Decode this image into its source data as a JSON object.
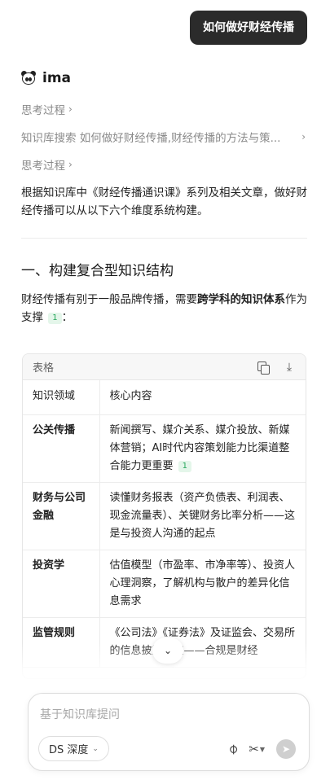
{
  "user_message": "如何做好财经传播",
  "assistant": {
    "name": "ima"
  },
  "steps": [
    {
      "label": "思考过程"
    },
    {
      "label": "知识库搜索 如何做好财经传播,财经传播的方法与策..."
    },
    {
      "label": "思考过程"
    }
  ],
  "intro": "根据知识库中《财经传播通识课》系列及相关文章，做好财经传播可以从以下六个维度系统构建。",
  "section": {
    "title": "一、构建复合型知识结构",
    "para_before": "财经传播有别于一般品牌传播，需要",
    "para_bold": "跨学科的知识体系",
    "para_after": "作为支撑",
    "para_end": "：",
    "citation": "1"
  },
  "table": {
    "label": "表格",
    "headers": [
      "知识领域",
      "核心内容"
    ],
    "rows": [
      {
        "domain": "公关传播",
        "content": "新闻撰写、媒介关系、媒介投放、新媒体营销；AI时代内容策划能力比渠道整合能力更重要",
        "citation": "1"
      },
      {
        "domain": "财务与公司金融",
        "content": "读懂财务报表（资产负债表、利润表、现金流量表）、关键财务比率分析——这是与投资人沟通的起点"
      },
      {
        "domain": "投资学",
        "content": "估值模型（市盈率、市净率等）、投资人心理洞察，了解机构与散户的差异化信息需求"
      },
      {
        "domain": "监管规则",
        "content": "《公司法》《证券法》及证监会、交易所的信息披露规定——合规是财经"
      }
    ]
  },
  "composer": {
    "placeholder": "基于知识库提问",
    "model_label": "DS 深度"
  },
  "icons": {
    "copy": "copy-icon",
    "download": "download-icon",
    "attach": "paperclip-icon",
    "tools": "scissors-icon",
    "send": "send-icon",
    "scroll": "chevron-down-icon"
  }
}
